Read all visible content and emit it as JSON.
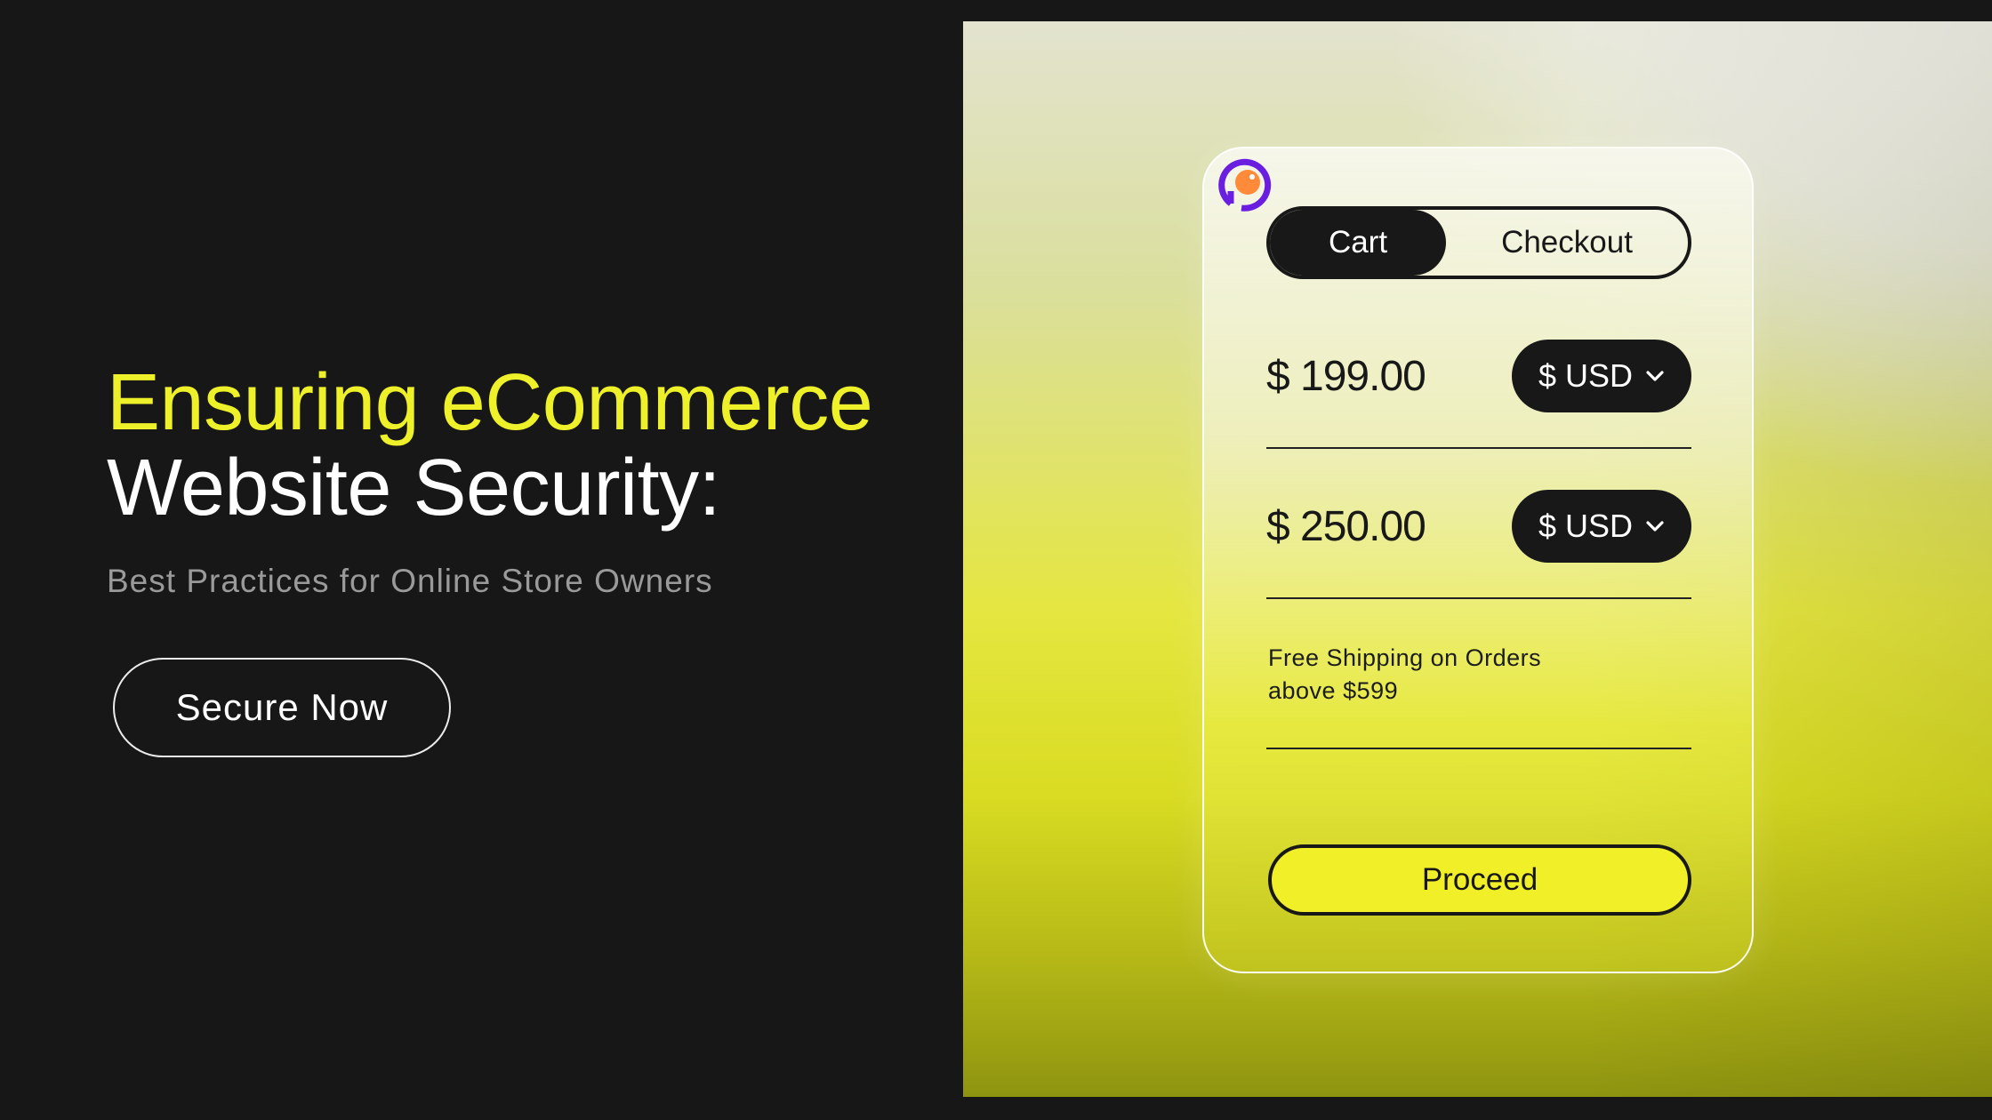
{
  "hero": {
    "title_line1": "Ensuring eCommerce",
    "title_line2": "Website Security:",
    "subtitle": "Best Practices for Online Store Owners",
    "cta_label": "Secure Now"
  },
  "card": {
    "logo_icon": "brand-logo-icon",
    "tabs": [
      {
        "label": "Cart",
        "active": true
      },
      {
        "label": "Checkout",
        "active": false
      }
    ],
    "prices": [
      {
        "amount": "$ 199.00",
        "currency": "$ USD",
        "icon": "chevron-down-icon"
      },
      {
        "amount": "$ 250.00",
        "currency": "$ USD",
        "icon": "chevron-down-icon"
      }
    ],
    "shipping_line1": "Free Shipping on Orders",
    "shipping_line2": "above $599",
    "proceed_label": "Proceed"
  },
  "colors": {
    "accent_yellow": "#eef029",
    "dark": "#171717",
    "button_yellow": "#f1ef27",
    "logo_purple": "#6a1fe0",
    "logo_orange": "#ff8a3a"
  }
}
